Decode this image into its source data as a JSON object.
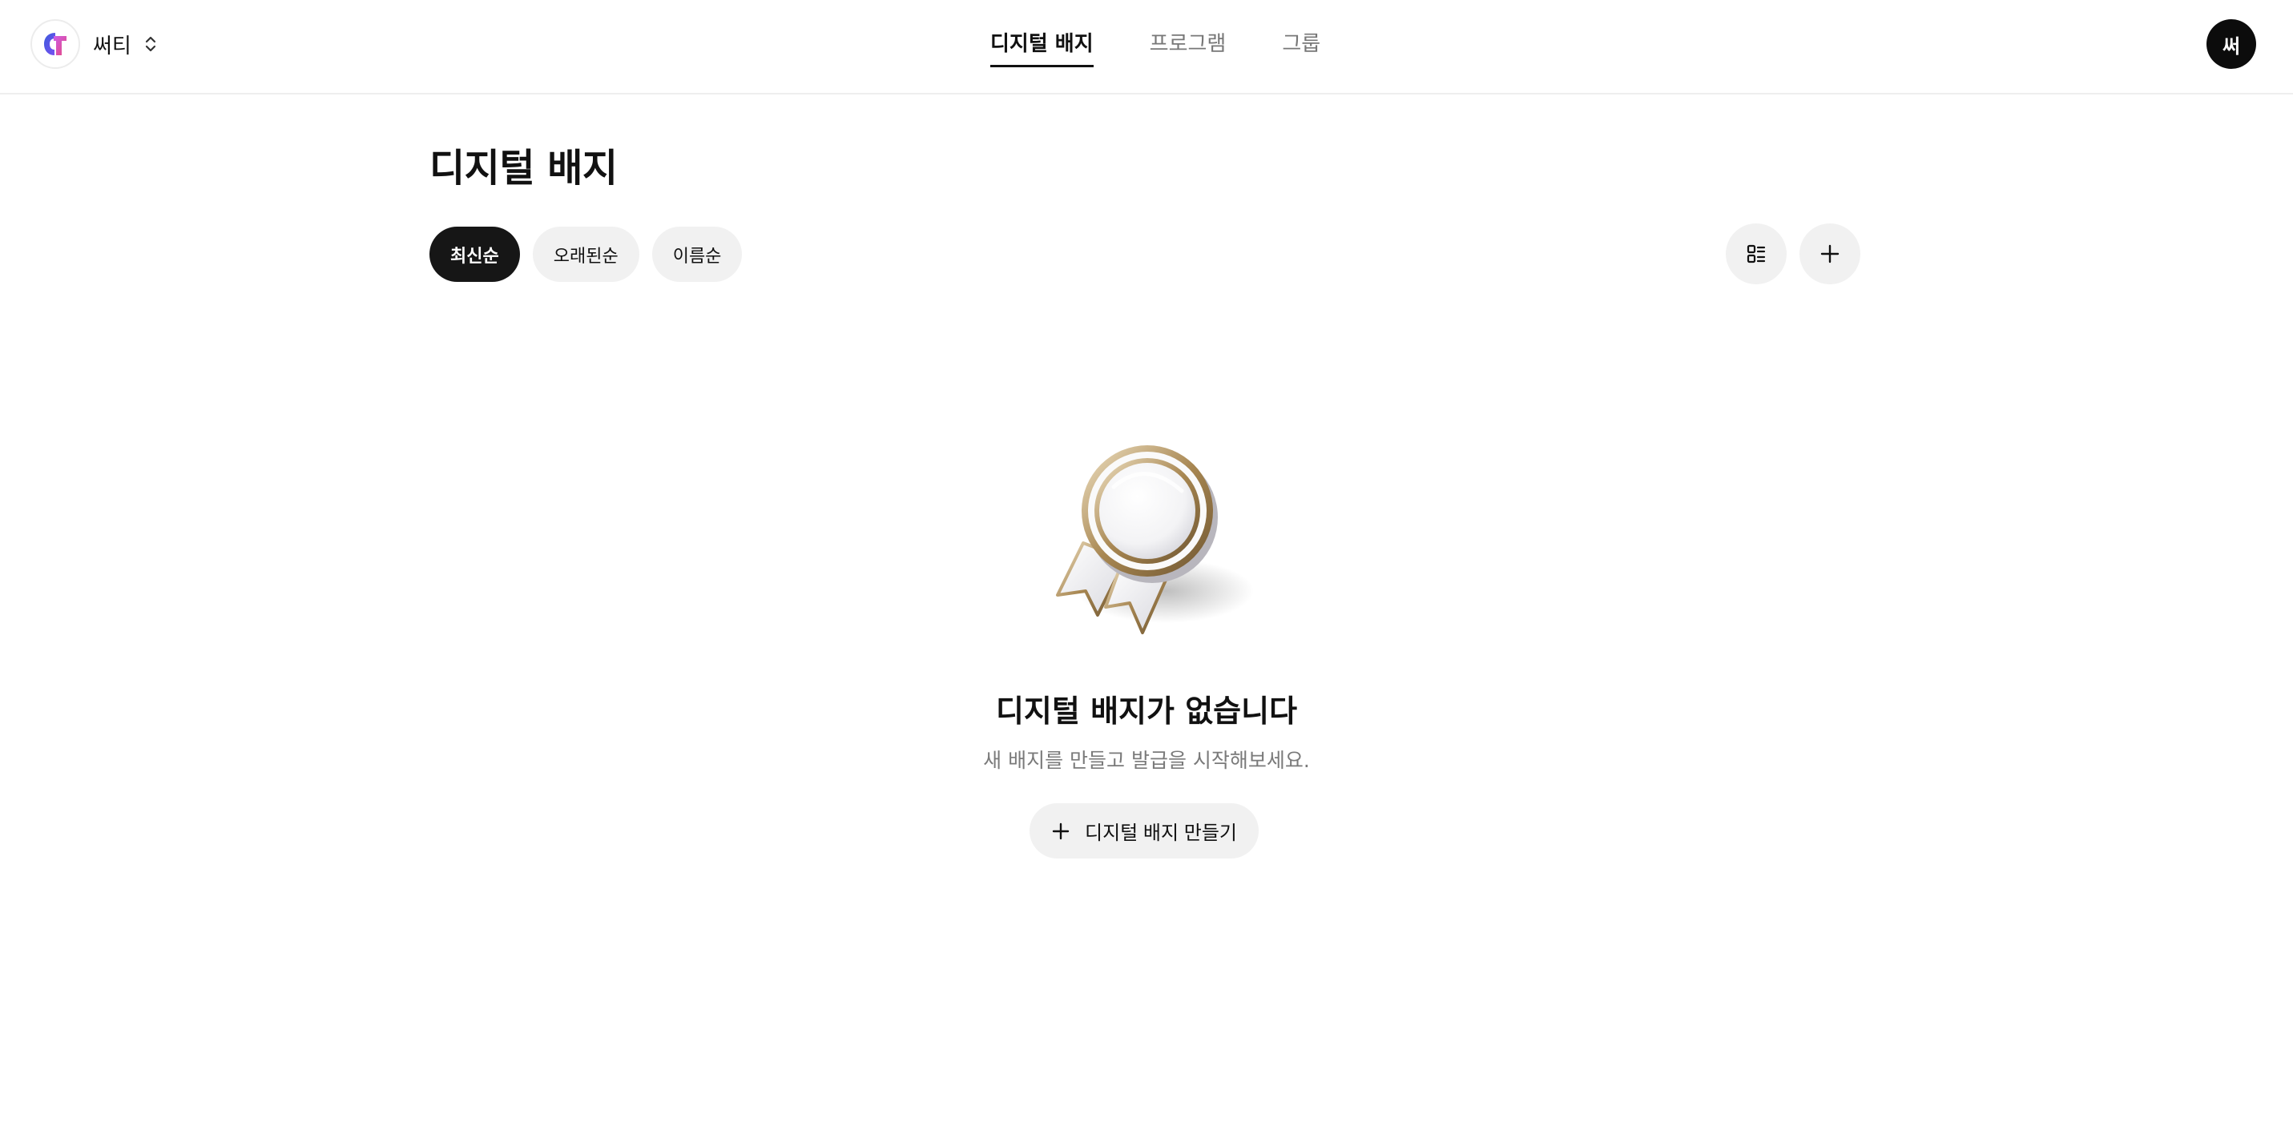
{
  "header": {
    "org_name": "써티",
    "org_logo_icon": "org-logo-icon",
    "org_switch_icon": "chevron-up-down-icon",
    "tabs": [
      {
        "label": "디지털 배지",
        "active": true
      },
      {
        "label": "프로그램",
        "active": false
      },
      {
        "label": "그룹",
        "active": false
      }
    ],
    "avatar_initial": "써"
  },
  "main": {
    "title": "디지털 배지",
    "sort_options": [
      {
        "label": "최신순",
        "active": true
      },
      {
        "label": "오래된순",
        "active": false
      },
      {
        "label": "이름순",
        "active": false
      }
    ],
    "tools": {
      "view_toggle_icon": "list-view-icon",
      "add_icon": "plus-icon"
    }
  },
  "empty_state": {
    "illustration": "medal-icon",
    "title": "디지털 배지가 없습니다",
    "subtitle": "새 배지를 만들고 발급을 시작해보세요.",
    "button_label": "디지털 배지 만들기",
    "button_icon": "plus-icon"
  },
  "colors": {
    "brand_blue": "#3b5bdb",
    "brand_pink": "#e64980",
    "active_chip": "#161616",
    "chip_bg": "#f1f1f1",
    "text_muted": "#7a7a7a"
  }
}
